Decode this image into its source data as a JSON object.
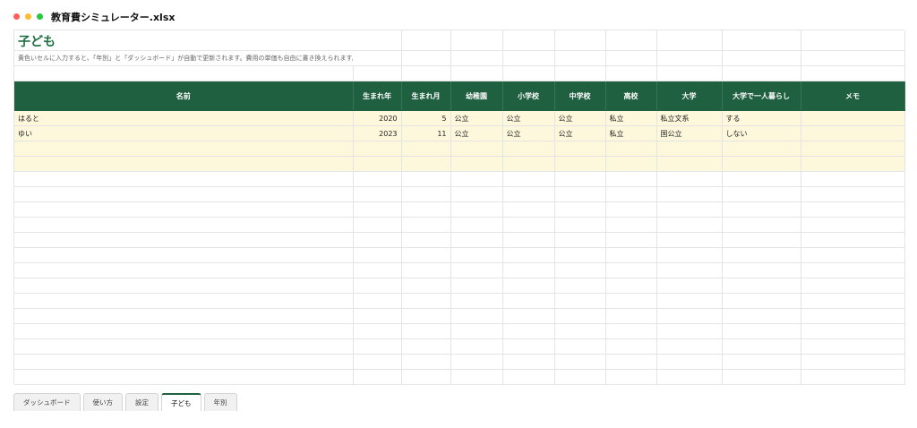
{
  "window": {
    "filename": "教育費シミュレーター.xlsx"
  },
  "sheet": {
    "title": "子ども",
    "note": "黄色いセルに入力すると、「年別」と「ダッシュボード」が自動で更新されます。費用の単価も自由に書き換えられます。",
    "headers": [
      "名前",
      "生まれ年",
      "生まれ月",
      "幼稚園",
      "小学校",
      "中学校",
      "高校",
      "大学",
      "大学で一人暮らし",
      "メモ"
    ],
    "rows": [
      [
        "はると",
        "2020",
        "5",
        "公立",
        "公立",
        "公立",
        "私立",
        "私立文系",
        "する",
        ""
      ],
      [
        "ゆい",
        "2023",
        "11",
        "公立",
        "公立",
        "公立",
        "私立",
        "国公立",
        "しない",
        ""
      ],
      [
        "",
        "",
        "",
        "",
        "",
        "",
        "",
        "",
        "",
        ""
      ],
      [
        "",
        "",
        "",
        "",
        "",
        "",
        "",
        "",
        "",
        ""
      ]
    ]
  },
  "tabs": [
    "ダッシュボード",
    "使い方",
    "設定",
    "子ども",
    "年別"
  ],
  "active_tab": "子ども",
  "colors": {
    "header_bg": "#1f6040",
    "input_bg": "#fdf7dc",
    "title": "#1e6f41"
  }
}
